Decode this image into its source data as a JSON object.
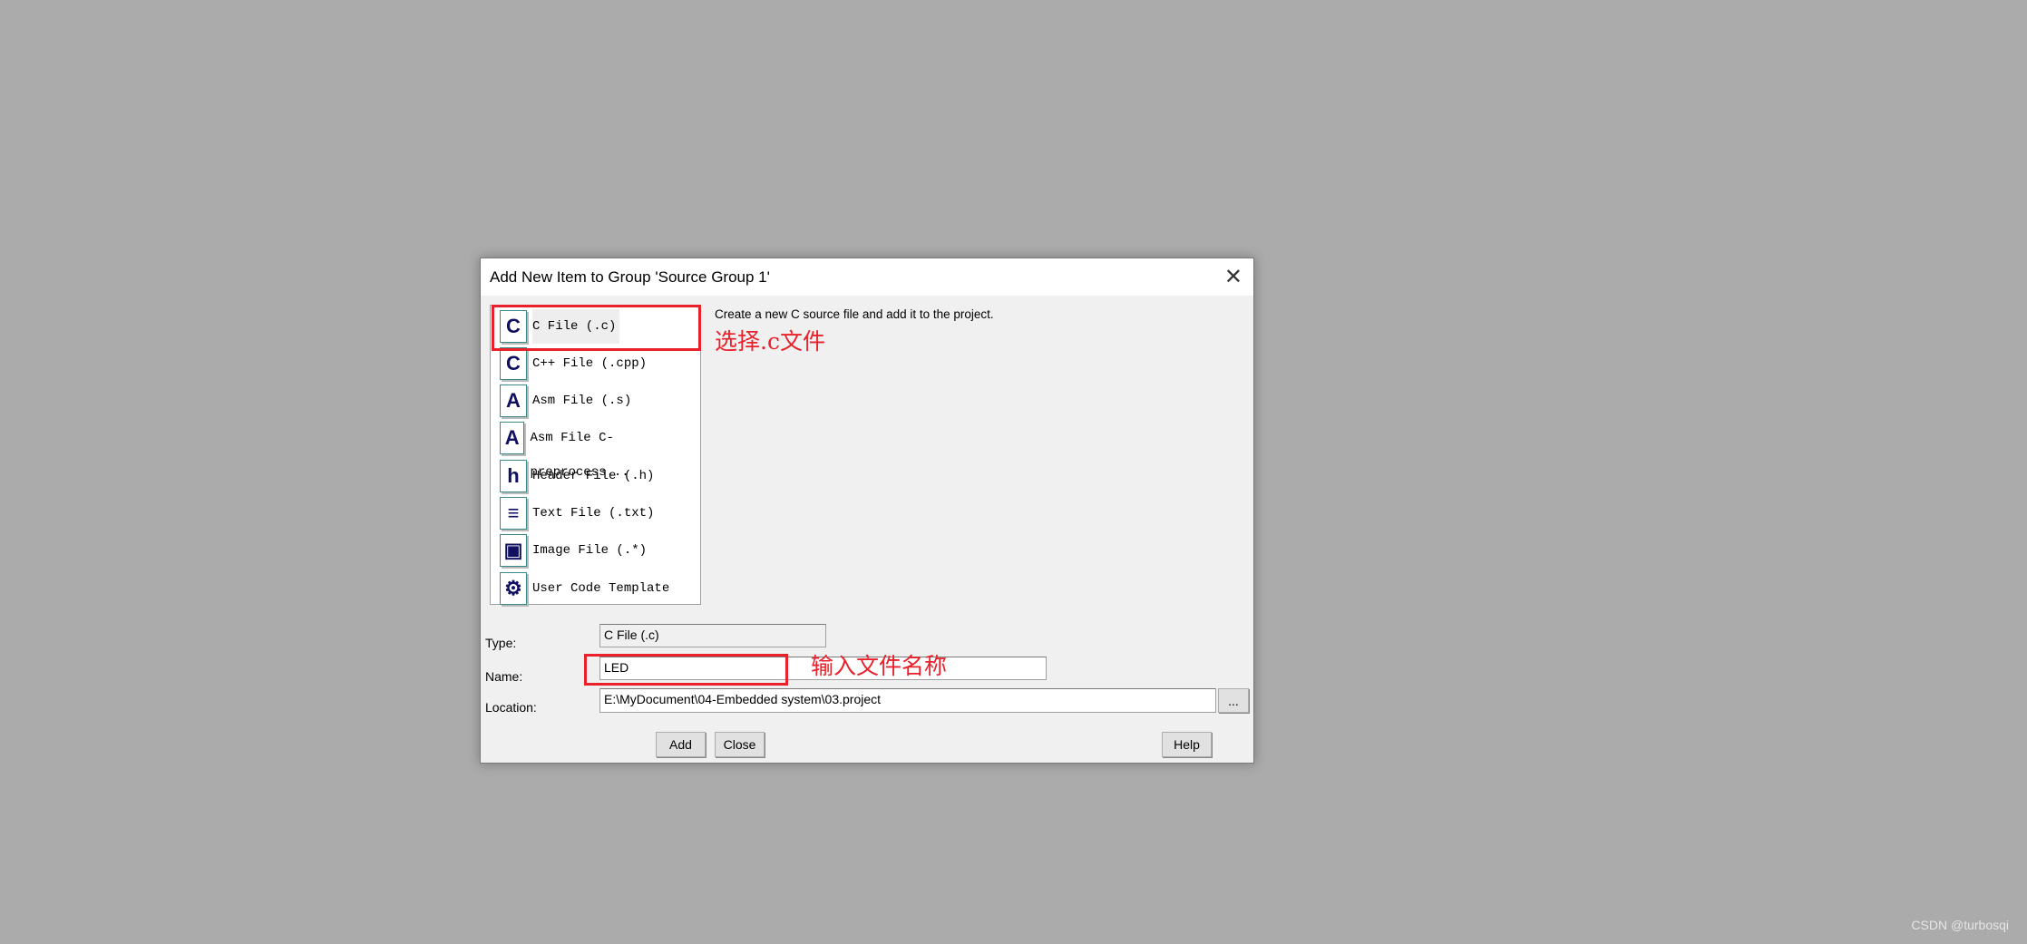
{
  "dialog": {
    "title": "Add New Item to Group 'Source Group 1'",
    "close_icon": "close-icon"
  },
  "file_types": [
    {
      "label": "C File (.c)",
      "icon": "C",
      "selected": true
    },
    {
      "label": "C++ File (.cpp)",
      "icon": "C"
    },
    {
      "label": "Asm File (.s)",
      "icon": "A"
    },
    {
      "label": "Asm File C-preprocess...",
      "icon": "A"
    },
    {
      "label": "Header File (.h)",
      "icon": "h"
    },
    {
      "label": "Text File (.txt)",
      "icon": "≡"
    },
    {
      "label": "Image File (.*)",
      "icon": "▣"
    },
    {
      "label": "User Code Template",
      "icon": "⚙"
    }
  ],
  "description": "Create a new C source file and add it to the project.",
  "annotations": {
    "select": "选择.c文件",
    "name": "输入文件名称",
    "color": "#e8212b"
  },
  "form": {
    "type_label": "Type:",
    "type_value": "C File (.c)",
    "name_label": "Name:",
    "name_value": "LED",
    "location_label": "Location:",
    "location_value": "E:\\MyDocument\\04-Embedded system\\03.project",
    "browse_label": "..."
  },
  "buttons": {
    "add": "Add",
    "close": "Close",
    "help": "Help"
  },
  "watermark": "CSDN @turbosqi"
}
